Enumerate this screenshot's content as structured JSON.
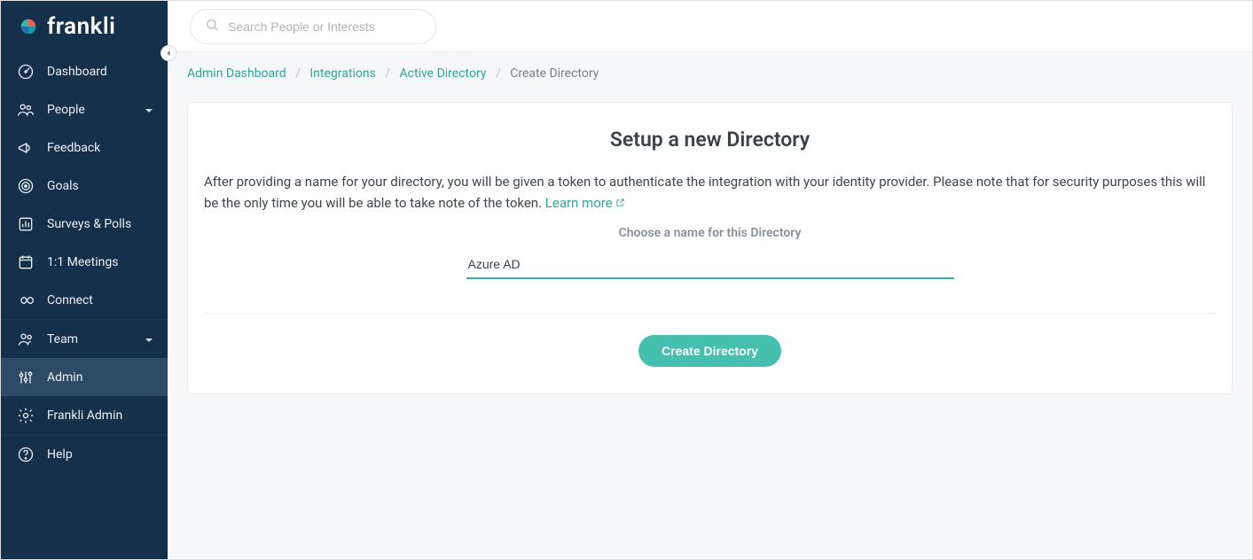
{
  "brand": {
    "name": "frankli"
  },
  "search": {
    "placeholder": "Search People or Interests"
  },
  "sidebar": {
    "items": [
      {
        "label": "Dashboard",
        "icon": "gauge-icon",
        "expandable": false
      },
      {
        "label": "People",
        "icon": "people-icon",
        "expandable": true
      },
      {
        "label": "Feedback",
        "icon": "megaphone-icon",
        "expandable": false
      },
      {
        "label": "Goals",
        "icon": "target-icon",
        "expandable": false
      },
      {
        "label": "Surveys & Polls",
        "icon": "barchart-icon",
        "expandable": false
      },
      {
        "label": "1:1 Meetings",
        "icon": "calendar-icon",
        "expandable": false
      },
      {
        "label": "Connect",
        "icon": "infinity-icon",
        "expandable": false
      },
      {
        "label": "Team",
        "icon": "team-icon",
        "expandable": true
      },
      {
        "label": "Admin",
        "icon": "sliders-icon",
        "expandable": false,
        "active": true
      },
      {
        "label": "Frankli Admin",
        "icon": "gear-icon",
        "expandable": false
      },
      {
        "label": "Help",
        "icon": "question-icon",
        "expandable": false
      }
    ]
  },
  "breadcrumbs": {
    "items": [
      {
        "label": "Admin Dashboard",
        "link": true
      },
      {
        "label": "Integrations",
        "link": true
      },
      {
        "label": "Active Directory",
        "link": true
      },
      {
        "label": "Create Directory",
        "link": false
      }
    ]
  },
  "page": {
    "title": "Setup a new Directory",
    "description": "After providing a name for your directory, you will be given a token to authenticate the integration with your identity provider. Please note that for security purposes this will be the only time you will be able to take note of the token. ",
    "learn_more": "Learn more",
    "field_label": "Choose a name for this Directory",
    "field_value": "Azure AD",
    "submit_label": "Create Directory"
  }
}
